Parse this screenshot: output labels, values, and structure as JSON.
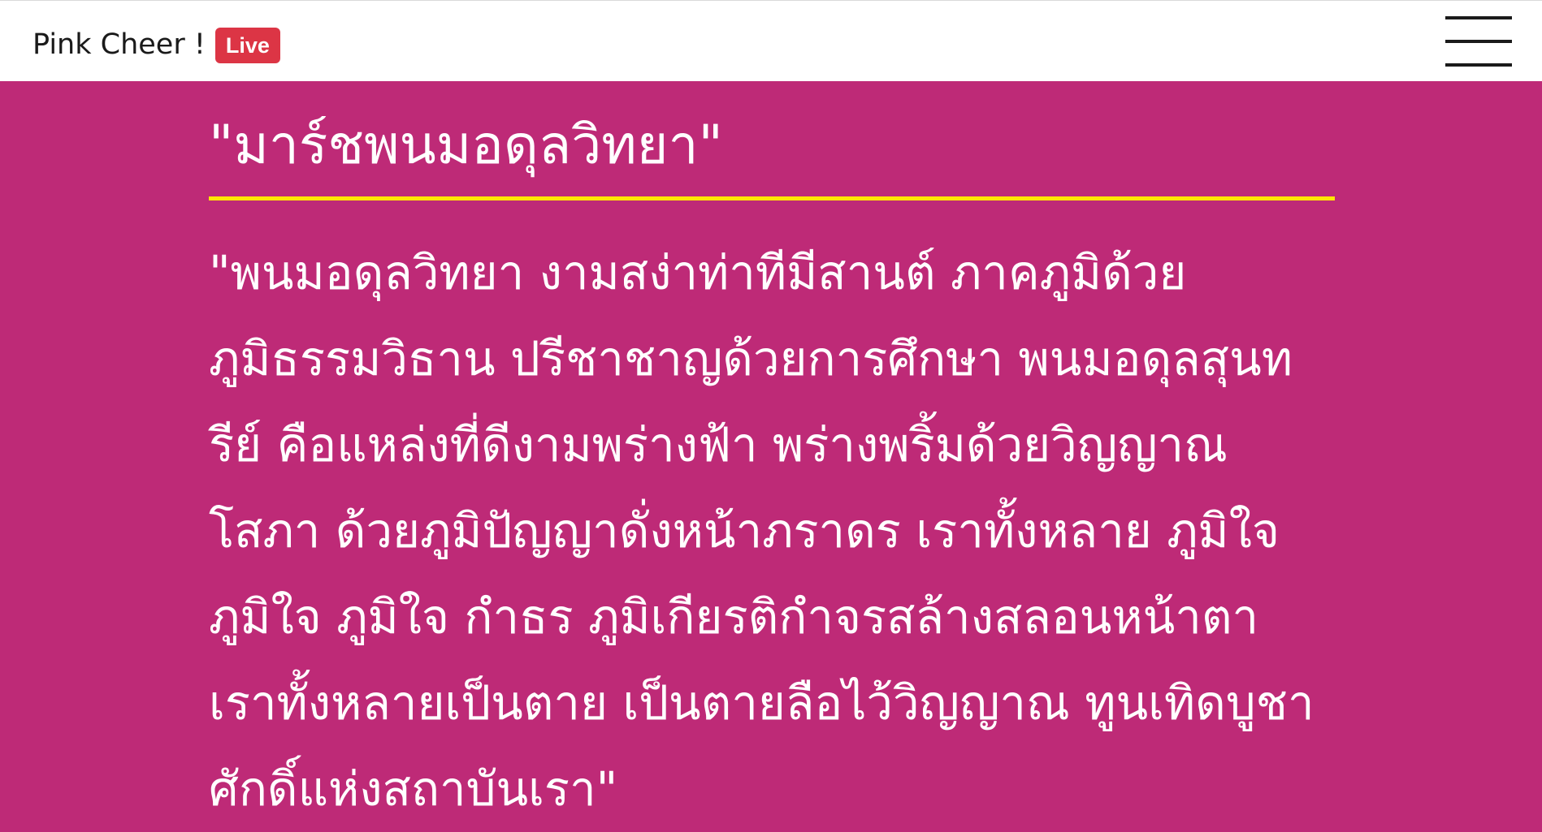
{
  "navbar": {
    "brand": "Pink Cheer !",
    "badge": "Live"
  },
  "song": {
    "title": "\"มาร์ชพนมอดุลวิทยา\"",
    "lyrics": "\"พนมอดุลวิทยา งามสง่าท่าทีมีสานต์ ภาคภูมิด้วยภูมิธรรมวิธาน ปรีชาชาญด้วยการศึกษา พนมอดุลสุนทรีย์ คือแหล่งที่ดีงามพร่างฟ้า พร่างพริ้มด้วยวิญญาณโสภา ด้วยภูมิปัญญาดั่งหน้าภราดร เราทั้งหลาย ภูมิใจ ภูมิใจ ภูมิใจ กำธร ภูมิเกียรติกำจรสล้างสลอนหน้าตา เราทั้งหลายเป็นตาย เป็นตายลือไว้วิญญาณ ทูนเทิดบูชาศักดิ์แห่งสถาบันเรา\""
  },
  "colors": {
    "background": "#be2a77",
    "navbar": "#ffffff",
    "badge": "#dc3545",
    "rule": "#ffe600",
    "text": "#ffffff"
  },
  "icons": {
    "menu": "hamburger-menu-icon"
  }
}
